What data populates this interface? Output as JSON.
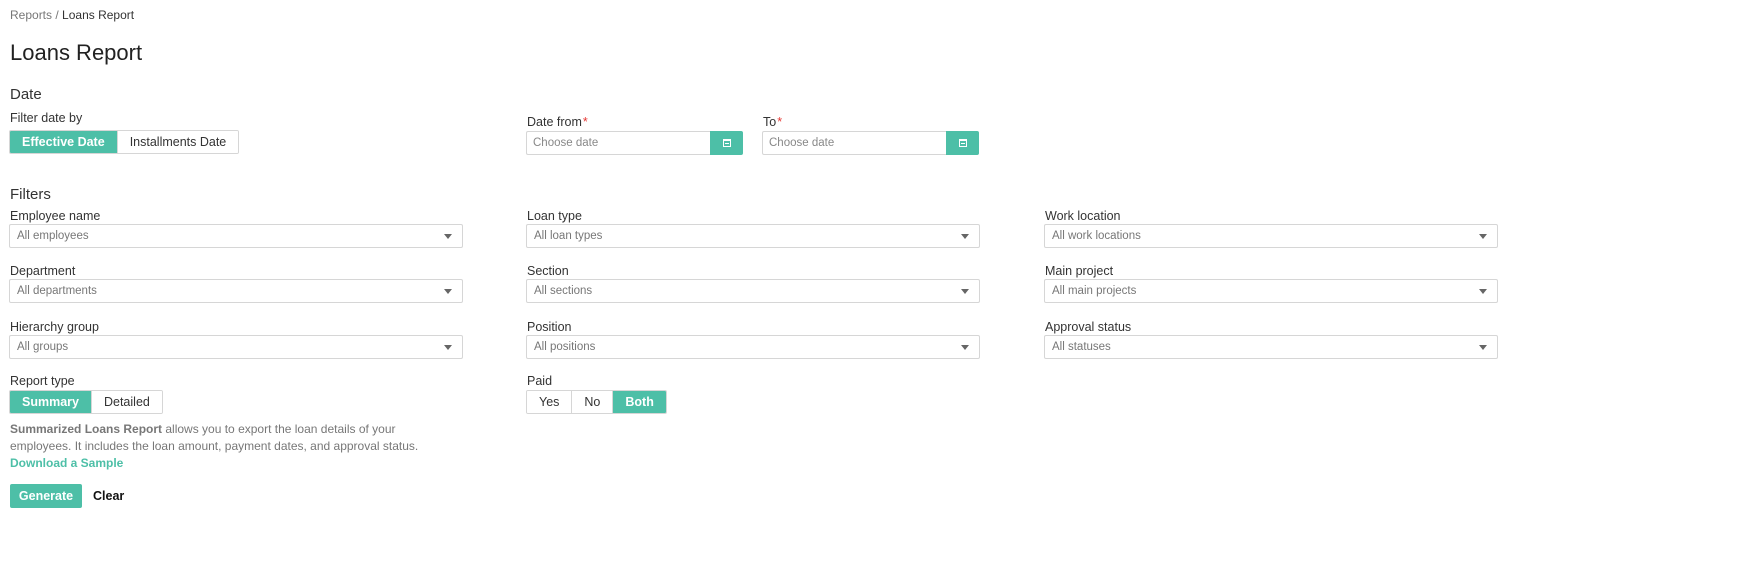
{
  "breadcrumb": {
    "parent": "Reports",
    "separator": " / ",
    "current": "Loans Report"
  },
  "page_title": "Loans Report",
  "date_section": {
    "heading": "Date",
    "filter_by_label": "Filter date by",
    "filter_by_options": [
      {
        "label": "Effective Date",
        "selected": true
      },
      {
        "label": "Installments Date",
        "selected": false
      }
    ],
    "date_from": {
      "label": "Date from",
      "required_mark": "*",
      "placeholder": "Choose date"
    },
    "date_to": {
      "label": "To",
      "required_mark": "*",
      "placeholder": "Choose date"
    }
  },
  "filters_section": {
    "heading": "Filters",
    "fields": [
      {
        "label": "Employee name",
        "value": "All employees"
      },
      {
        "label": "Loan type",
        "value": "All loan types"
      },
      {
        "label": "Work location",
        "value": "All work locations"
      },
      {
        "label": "Department",
        "value": "All departments"
      },
      {
        "label": "Section",
        "value": "All sections"
      },
      {
        "label": "Main project",
        "value": "All main projects"
      },
      {
        "label": "Hierarchy group",
        "value": "All groups"
      },
      {
        "label": "Position",
        "value": "All positions"
      },
      {
        "label": "Approval status",
        "value": "All statuses"
      }
    ],
    "report_type": {
      "label": "Report type",
      "options": [
        {
          "label": "Summary",
          "selected": true
        },
        {
          "label": "Detailed",
          "selected": false
        }
      ]
    },
    "paid": {
      "label": "Paid",
      "options": [
        {
          "label": "Yes",
          "selected": false
        },
        {
          "label": "No",
          "selected": false
        },
        {
          "label": "Both",
          "selected": true
        }
      ]
    },
    "description": {
      "bold": "Summarized Loans Report",
      "text": " allows you to export the loan details of your employees. It includes the loan amount, payment dates, and approval status. ",
      "link": "Download a Sample"
    }
  },
  "actions": {
    "generate": "Generate",
    "clear": "Clear"
  },
  "colors": {
    "accent": "#4dbfa7",
    "required": "#e53935"
  }
}
